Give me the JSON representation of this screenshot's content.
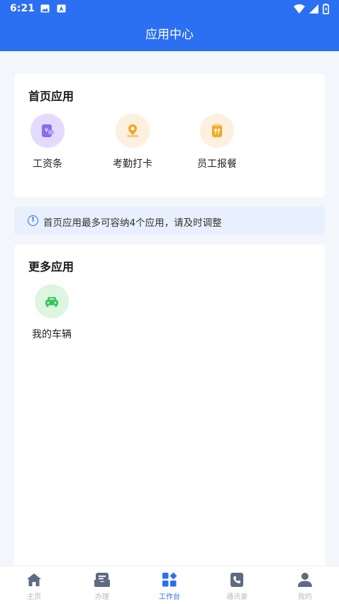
{
  "status_bar": {
    "time": "6:21"
  },
  "header": {
    "title": "应用中心"
  },
  "home_apps": {
    "title": "首页应用",
    "items": [
      {
        "label": "工资条",
        "icon": "salary-wallet-icon"
      },
      {
        "label": "考勤打卡",
        "icon": "attendance-location-icon"
      },
      {
        "label": "员工报餐",
        "icon": "meal-order-icon"
      }
    ]
  },
  "notice": {
    "text": "首页应用最多可容纳4个应用，请及时调整"
  },
  "more_apps": {
    "title": "更多应用",
    "items": [
      {
        "label": "我的车辆",
        "icon": "car-icon"
      }
    ]
  },
  "tabbar": {
    "items": [
      {
        "label": "主页",
        "icon": "home-icon"
      },
      {
        "label": "办理",
        "icon": "inbox-icon"
      },
      {
        "label": "工作台",
        "icon": "workbench-icon"
      },
      {
        "label": "通讯录",
        "icon": "phone-book-icon"
      },
      {
        "label": "我的",
        "icon": "user-icon"
      }
    ],
    "active": "工作台"
  },
  "colors": {
    "primary": "#2b6ff2",
    "purple": "#8b6cf0",
    "orange": "#f5a623",
    "green": "#34c759"
  }
}
